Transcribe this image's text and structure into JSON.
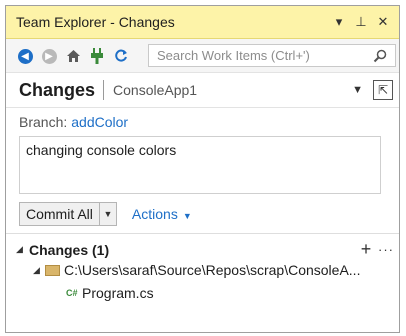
{
  "window": {
    "title": "Team Explorer - Changes",
    "dropdown_icon": "chevron-down-icon",
    "pin_icon": "pin-icon",
    "close_icon": "close-icon"
  },
  "toolbar": {
    "icons": [
      "back-icon",
      "forward-icon",
      "home-icon",
      "connect-icon",
      "refresh-icon"
    ],
    "search": {
      "placeholder": "Search Work Items (Ctrl+')"
    }
  },
  "header": {
    "title": "Changes",
    "repo": "ConsoleApp1"
  },
  "branch": {
    "label": "Branch:",
    "name": "addColor"
  },
  "commit": {
    "message": "changing console colors",
    "button_label": "Commit All",
    "actions_label": "Actions"
  },
  "changes": {
    "section_title": "Changes (1)",
    "add_symbol": "+",
    "more_symbol": "···",
    "folder_path": "C:\\Users\\saraf\\Source\\Repos\\scrap\\ConsoleA...",
    "file_type": "C#",
    "file_name": "Program.cs"
  },
  "colors": {
    "titlebar": "#fdf3a8",
    "accent": "#1e6fc7"
  }
}
